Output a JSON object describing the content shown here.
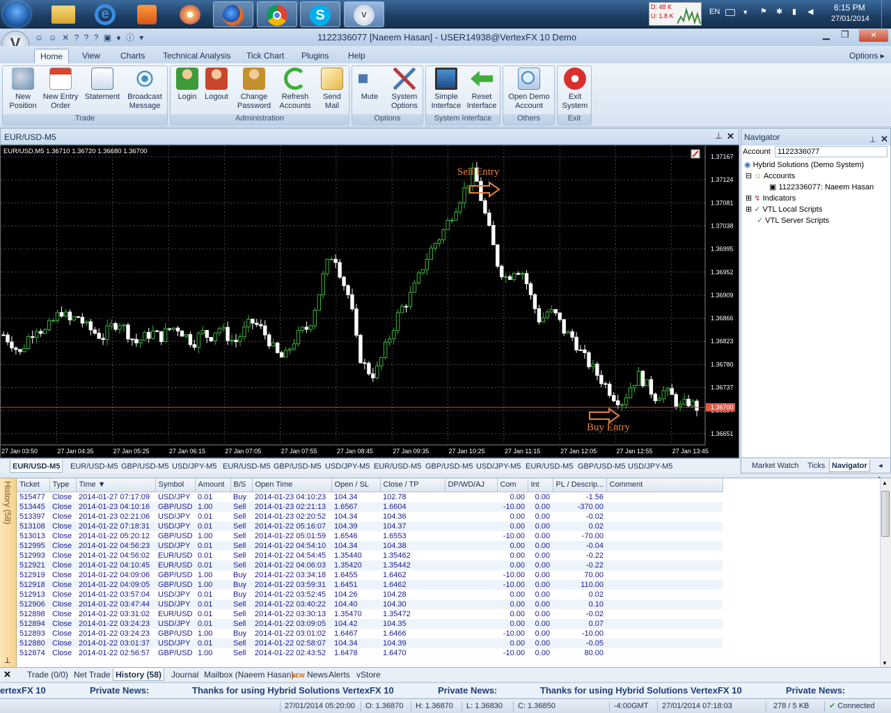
{
  "taskbar": {
    "net_down": "D: 48 K",
    "net_up": "U: 1.8 K",
    "lang": "EN",
    "time": "6:15 PM",
    "date": "27/01/2014"
  },
  "window": {
    "title": "1122336077 [Naeem Hasan] - USER14938@VertexFX 10 Demo",
    "options": "Options"
  },
  "ribbon_tabs": [
    "Home",
    "View",
    "Charts",
    "Technical Analysis",
    "Tick Chart",
    "Plugins",
    "Help"
  ],
  "ribbon": {
    "groups": [
      {
        "label": "Trade",
        "buttons": [
          {
            "l1": "New",
            "l2": "Position",
            "icon": "new-position-icon",
            "color": "#6b8fb5"
          },
          {
            "l1": "New Entry",
            "l2": "Order",
            "icon": "calendar-icon",
            "color": "#d9442e"
          },
          {
            "l1": "Statement",
            "l2": "",
            "icon": "statement-icon",
            "color": "#4a78b0"
          },
          {
            "l1": "Broadcast",
            "l2": "Message",
            "icon": "broadcast-icon",
            "color": "#3a8fd0"
          }
        ]
      },
      {
        "label": "Administration",
        "buttons": [
          {
            "l1": "Login",
            "l2": "",
            "icon": "login-icon",
            "color": "#3f9a3a"
          },
          {
            "l1": "Logout",
            "l2": "",
            "icon": "logout-icon",
            "color": "#c9462e"
          },
          {
            "l1": "Change",
            "l2": "Password",
            "icon": "password-icon",
            "color": "#c48f2e"
          },
          {
            "l1": "Refresh",
            "l2": "Accounts",
            "icon": "refresh-icon",
            "color": "#3fae3a"
          },
          {
            "l1": "Send",
            "l2": "Mail",
            "icon": "mail-icon",
            "color": "#e8b84a"
          }
        ]
      },
      {
        "label": "Options",
        "buttons": [
          {
            "l1": "Mute",
            "l2": "",
            "icon": "speaker-icon",
            "color": "#4a78b0"
          },
          {
            "l1": "System",
            "l2": "Options",
            "icon": "tools-icon",
            "color": "#b53a3a"
          }
        ]
      },
      {
        "label": "System Interface",
        "buttons": [
          {
            "l1": "Simple",
            "l2": "Interface",
            "icon": "monitor-icon",
            "color": "#3a6fb0"
          },
          {
            "l1": "Reset",
            "l2": "Interface",
            "icon": "reset-arrow-icon",
            "color": "#3fae3a"
          }
        ]
      },
      {
        "label": "Others",
        "buttons": [
          {
            "l1": "Open Demo",
            "l2": "Account",
            "icon": "demo-account-icon",
            "color": "#4a8fd0"
          }
        ]
      },
      {
        "label": "Exit",
        "buttons": [
          {
            "l1": "Exit",
            "l2": "System",
            "icon": "power-icon",
            "color": "#d9302e"
          }
        ]
      }
    ]
  },
  "chart_window": {
    "title": "EUR/USD-M5",
    "info": "EUR/USD,M5  1.36710  1.36720  1.36680  1.36700",
    "sell_label": "Sell Entry",
    "buy_label": "Buy Entry",
    "current_price": "1.36700"
  },
  "chart_data": {
    "type": "candlestick",
    "symbol": "EUR/USD",
    "timeframe": "M5",
    "y_ticks": [
      "1.37167",
      "1.37124",
      "1.37081",
      "1.37038",
      "1.36995",
      "1.36952",
      "1.36909",
      "1.36866",
      "1.36823",
      "1.36780",
      "1.36737",
      "1.36694",
      "1.36651"
    ],
    "x_ticks": [
      "27 Jan 03:50",
      "27 Jan 04:35",
      "27 Jan 05:25",
      "27 Jan 06:15",
      "27 Jan 07:05",
      "27 Jan 07:55",
      "27 Jan 08:45",
      "27 Jan 09:35",
      "27 Jan 10:25",
      "27 Jan 11:15",
      "27 Jan 12:05",
      "27 Jan 12:55",
      "27 Jan 13:45"
    ],
    "ylim": [
      1.3663,
      1.3718
    ],
    "close_path": [
      1.36835,
      1.3682,
      1.368,
      1.3683,
      1.3685,
      1.3684,
      1.3686,
      1.3688,
      1.3686,
      1.3687,
      1.3685,
      1.3684,
      1.3683,
      1.3685,
      1.3686,
      1.3684,
      1.3682,
      1.3683,
      1.3684,
      1.3683,
      1.36845,
      1.3685,
      1.36835,
      1.3682,
      1.3684,
      1.3683,
      1.3685,
      1.36835,
      1.3682,
      1.3684,
      1.3686,
      1.3685,
      1.3683,
      1.368,
      1.3679,
      1.3682,
      1.3684,
      1.3685,
      1.369,
      1.3696,
      1.3699,
      1.3694,
      1.369,
      1.368,
      1.3677,
      1.3676,
      1.368,
      1.3684,
      1.3688,
      1.369,
      1.3693,
      1.3697,
      1.37,
      1.3702,
      1.3705,
      1.3708,
      1.3711,
      1.3714,
      1.3708,
      1.3702,
      1.3696,
      1.3694,
      1.3696,
      1.3695,
      1.369,
      1.3686,
      1.3688,
      1.3687,
      1.3684,
      1.3683,
      1.368,
      1.3678,
      1.3676,
      1.3674,
      1.3672,
      1.3671,
      1.3674,
      1.3676,
      1.3674,
      1.3672,
      1.3673,
      1.3672,
      1.367,
      1.3671,
      1.367
    ],
    "current_price": 1.367,
    "bull_color": "#3cb43c",
    "bear_color": "#ffffff"
  },
  "chart_tabs": [
    "EUR/USD-M5",
    "EUR/USD-M5",
    "GBP/USD-M5",
    "USD/JPY-M5",
    "EUR/USD-M5",
    "GBP/USD-M5",
    "USD/JPY-M5",
    "EUR/USD-M5",
    "GBP/USD-M5",
    "USD/JPY-M5",
    "EUR/USD-M5",
    "GBP/USD-M5",
    "USD/JPY-M5"
  ],
  "navigator": {
    "title": "Navigator",
    "account_label": "Account",
    "account_value": "1122336077",
    "tree": [
      "Hybrid Solutions (Demo System)",
      "Accounts",
      "1122336077: Naeem Hasan",
      "Indicators",
      "VTL Local Scripts",
      "VTL Server Scripts"
    ],
    "tabs": [
      "Market Watch",
      "Ticks",
      "Navigator"
    ]
  },
  "history": {
    "side_label": "History (58)",
    "columns": [
      "Ticket",
      "Type",
      "Time",
      "Symbol",
      "Amount",
      "B/S",
      "Open Time",
      "Open / SL",
      "Close / TP",
      "DP/WD/AJ",
      "Com",
      "Int",
      "PL / Descrip...",
      "Comment"
    ],
    "rows": [
      [
        "515477",
        "Close",
        "2014-01-27 07:17:09",
        "USD/JPY",
        "0.01",
        "Buy",
        "2014-01-23 04:10:23",
        "104.34",
        "102.78",
        "",
        "0.00",
        "0.00",
        "-1.56",
        ""
      ],
      [
        "513445",
        "Close",
        "2014-01-23 04:10:16",
        "GBP/USD",
        "1.00",
        "Sell",
        "2014-01-23 02:21:13",
        "1.6567",
        "1.6604",
        "",
        "-10.00",
        "0.00",
        "-370.00",
        ""
      ],
      [
        "513397",
        "Close",
        "2014-01-23 02:21:06",
        "USD/JPY",
        "0.01",
        "Sell",
        "2014-01-23 02:20:52",
        "104.34",
        "104.36",
        "",
        "0.00",
        "0.00",
        "-0.02",
        ""
      ],
      [
        "513108",
        "Close",
        "2014-01-22 07:18:31",
        "USD/JPY",
        "0.01",
        "Sell",
        "2014-01-22 05:16:07",
        "104.39",
        "104.37",
        "",
        "0.00",
        "0.00",
        "0.02",
        ""
      ],
      [
        "513013",
        "Close",
        "2014-01-22 05:20:12",
        "GBP/USD",
        "1.00",
        "Sell",
        "2014-01-22 05:01:59",
        "1.6546",
        "1.6553",
        "",
        "-10.00",
        "0.00",
        "-70.00",
        ""
      ],
      [
        "512995",
        "Close",
        "2014-01-22 04:56:23",
        "USD/JPY",
        "0.01",
        "Sell",
        "2014-01-22 04:54:10",
        "104.34",
        "104.38",
        "",
        "0.00",
        "0.00",
        "-0.04",
        ""
      ],
      [
        "512993",
        "Close",
        "2014-01-22 04:56:02",
        "EUR/USD",
        "0.01",
        "Sell",
        "2014-01-22 04:54:45",
        "1.35440",
        "1.35462",
        "",
        "0.00",
        "0.00",
        "-0.22",
        ""
      ],
      [
        "512921",
        "Close",
        "2014-01-22 04:10:45",
        "EUR/USD",
        "0.01",
        "Sell",
        "2014-01-22 04:06:03",
        "1.35420",
        "1.35442",
        "",
        "0.00",
        "0.00",
        "-0.22",
        ""
      ],
      [
        "512919",
        "Close",
        "2014-01-22 04:09:06",
        "GBP/USD",
        "1.00",
        "Buy",
        "2014-01-22 03:34:18",
        "1.6455",
        "1.6462",
        "",
        "-10.00",
        "0.00",
        "70.00",
        ""
      ],
      [
        "512918",
        "Close",
        "2014-01-22 04:09:05",
        "GBP/USD",
        "1.00",
        "Buy",
        "2014-01-22 03:59:31",
        "1.6451",
        "1.6462",
        "",
        "-10.00",
        "0.00",
        "110.00",
        ""
      ],
      [
        "512913",
        "Close",
        "2014-01-22 03:57:04",
        "USD/JPY",
        "0.01",
        "Buy",
        "2014-01-22 03:52:45",
        "104.26",
        "104.28",
        "",
        "0.00",
        "0.00",
        "0.02",
        ""
      ],
      [
        "512906",
        "Close",
        "2014-01-22 03:47:44",
        "USD/JPY",
        "0.01",
        "Sell",
        "2014-01-22 03:40:22",
        "104.40",
        "104.30",
        "",
        "0.00",
        "0.00",
        "0.10",
        ""
      ],
      [
        "512898",
        "Close",
        "2014-01-22 03:31:02",
        "EUR/USD",
        "0.01",
        "Sell",
        "2014-01-22 03:30:13",
        "1.35470",
        "1.35472",
        "",
        "0.00",
        "0.00",
        "-0.02",
        ""
      ],
      [
        "512894",
        "Close",
        "2014-01-22 03:24:23",
        "USD/JPY",
        "0.01",
        "Sell",
        "2014-01-22 03:09:05",
        "104.42",
        "104.35",
        "",
        "0.00",
        "0.00",
        "0.07",
        ""
      ],
      [
        "512893",
        "Close",
        "2014-01-22 03:24:23",
        "GBP/USD",
        "1.00",
        "Buy",
        "2014-01-22 03:01:02",
        "1.6467",
        "1.6466",
        "",
        "-10.00",
        "0.00",
        "-10.00",
        ""
      ],
      [
        "512880",
        "Close",
        "2014-01-22 03:01:37",
        "USD/JPY",
        "0.01",
        "Sell",
        "2014-01-22 02:58:07",
        "104.34",
        "104.39",
        "",
        "0.00",
        "0.00",
        "-0.05",
        ""
      ],
      [
        "512874",
        "Close",
        "2014-01-22 02:56:57",
        "GBP/USD",
        "1.00",
        "Sell",
        "2014-01-22 02:43:52",
        "1.6478",
        "1.6470",
        "",
        "-10.00",
        "0.00",
        "80.00",
        ""
      ]
    ]
  },
  "bottom_tabs": [
    "Trade (0/0)",
    "Net Trade",
    "History (58)",
    "Journal",
    "Mailbox (Naeem Hasan)",
    "News",
    "Alerts",
    "vStore"
  ],
  "ticker": {
    "brand": "VertexFX 10",
    "label": "Private News:",
    "message": "Thanks for using Hybrid Solutions VertexFX 10"
  },
  "status": {
    "datetime": "27/01/2014 05:20:00",
    "open": "O: 1.36870",
    "high": "H: 1.36870",
    "low": "L: 1.36830",
    "close": "C: 1.36850",
    "gmt": "-4:00GMT",
    "server_time": "27/01/2014 07:18:03",
    "traffic": "278 / 5 KB",
    "connection": "Connected"
  }
}
